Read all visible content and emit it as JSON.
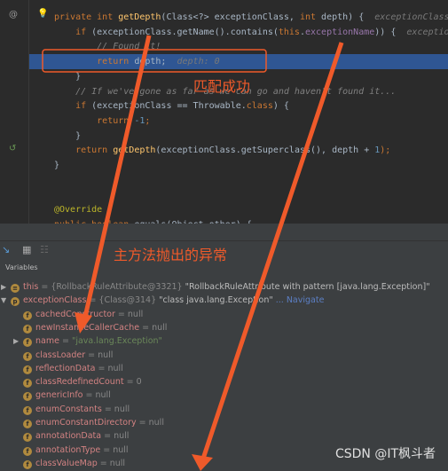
{
  "editor": {
    "lines": [
      {
        "parts": [
          [
            "kw",
            "private int "
          ],
          [
            "fn",
            "getDepth"
          ],
          [
            "",
            "(Class<?> exceptionClass, "
          ],
          [
            "kw",
            "int"
          ],
          [
            "",
            " depth) {  "
          ],
          [
            "hint",
            "exceptionClass"
          ]
        ]
      },
      {
        "parts": [
          [
            "kw",
            "    if "
          ],
          [
            "",
            "(exceptionClass.getName().contains("
          ],
          [
            "kw",
            "this"
          ],
          [
            "",
            "."
          ],
          [
            "fld",
            "exceptionName"
          ],
          [
            "",
            ")) {  "
          ],
          [
            "hint",
            "exceptionName"
          ]
        ]
      },
      {
        "parts": [
          [
            "cm",
            "        // Found it!"
          ]
        ]
      },
      {
        "parts": [
          [
            "kw",
            "        return "
          ],
          [
            "",
            "depth;  "
          ],
          [
            "hint",
            "depth: 0"
          ]
        ],
        "highlight": true
      },
      {
        "parts": [
          [
            "",
            "    }"
          ]
        ]
      },
      {
        "parts": [
          [
            "cm",
            "    // If we've gone as far as we can go and haven't found it..."
          ]
        ]
      },
      {
        "parts": [
          [
            "kw",
            "    if "
          ],
          [
            "",
            "(exceptionClass == Throwable."
          ],
          [
            "kw",
            "class"
          ],
          [
            "",
            ") {"
          ]
        ]
      },
      {
        "parts": [
          [
            "kw",
            "        return "
          ],
          [
            "num",
            "-1"
          ],
          [
            "kw",
            ";"
          ]
        ]
      },
      {
        "parts": [
          [
            "",
            "    }"
          ]
        ]
      },
      {
        "parts": [
          [
            "kw",
            "    return "
          ],
          [
            "fn",
            "getDepth"
          ],
          [
            "",
            "(exceptionClass.getSuperclass(), depth + "
          ],
          [
            "num",
            "1"
          ],
          [
            "kw",
            ");"
          ]
        ]
      },
      {
        "parts": [
          [
            "",
            "}"
          ]
        ]
      },
      {
        "parts": [
          [
            "",
            ""
          ]
        ]
      },
      {
        "parts": [
          [
            "",
            ""
          ]
        ]
      },
      {
        "parts": [
          [
            "ann",
            "@Override"
          ]
        ]
      },
      {
        "parts": [
          [
            "kw",
            "public boolean "
          ],
          [
            "",
            "equals(Object other) {"
          ]
        ]
      }
    ]
  },
  "variables": {
    "label": "Variables",
    "items": [
      {
        "name": "this",
        "badge": "≡",
        "rest": " = {RollbackRuleAttribute@3321} ",
        "str": "\"RollbackRuleAttribute with pattern [java.lang.Exception]\"",
        "level": 0,
        "expand": "▶"
      },
      {
        "name": "exceptionClass",
        "badge": "p",
        "rest": " = {Class@314} ",
        "str": "\"class java.lang.Exception\"",
        "nav": " ... Navigate",
        "level": 0,
        "expand": "▼"
      },
      {
        "name": "cachedConstructor",
        "badge": "f",
        "rest": " = null",
        "level": 1
      },
      {
        "name": "newInstanceCallerCache",
        "badge": "f",
        "rest": " = null",
        "level": 1
      },
      {
        "name": "name",
        "badge": "f",
        "rest": " = ",
        "val": "\"java.lang.Exception\"",
        "level": 1,
        "expand": "▶"
      },
      {
        "name": "classLoader",
        "badge": "f",
        "rest": " = null",
        "level": 1
      },
      {
        "name": "reflectionData",
        "badge": "f",
        "rest": " = null",
        "level": 1
      },
      {
        "name": "classRedefinedCount",
        "badge": "f",
        "rest": " = 0",
        "level": 1
      },
      {
        "name": "genericInfo",
        "badge": "f",
        "rest": " = null",
        "level": 1
      },
      {
        "name": "enumConstants",
        "badge": "f",
        "rest": " = null",
        "level": 1
      },
      {
        "name": "enumConstantDirectory",
        "badge": "f",
        "rest": " = null",
        "level": 1
      },
      {
        "name": "annotationData",
        "badge": "f",
        "rest": " = null",
        "level": 1
      },
      {
        "name": "annotationType",
        "badge": "f",
        "rest": " = null",
        "level": 1
      },
      {
        "name": "classValueMap",
        "badge": "f",
        "rest": " = null",
        "level": 1
      }
    ]
  },
  "annotations": {
    "match_success": "匹配成功",
    "main_exception": "主方法抛出的异常",
    "color": "#ef5a2a"
  },
  "watermark": "CSDN @IT枫斗者"
}
